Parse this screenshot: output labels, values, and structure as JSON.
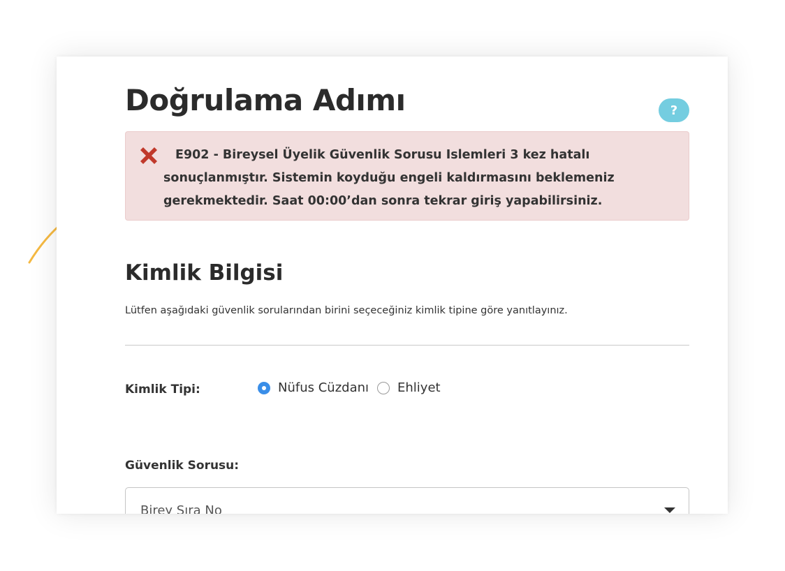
{
  "page": {
    "title": "Doğrulama Adımı",
    "help_label": "?"
  },
  "alert": {
    "message": "E902 - Bireysel Üyelik Güvenlik Sorusu Islemleri 3 kez hatalı sonuçlanmıştır. Sistemin koyduğu engeli kaldırmasını beklemeniz gerekmektedir. Saat 00:00’dan sonra tekrar giriş yapabilirsiniz.",
    "icon": "close-icon",
    "background": "#f2dede",
    "icon_color": "#c0392b"
  },
  "identity": {
    "section_title": "Kimlik Bilgisi",
    "description": "Lütfen aşağıdaki güvenlik sorularından birini seçeceğiniz kimlik tipine göre yanıtlayınız.",
    "id_type_label": "Kimlik Tipi:",
    "options": [
      {
        "label": "Nüfus Cüzdanı",
        "checked": true
      },
      {
        "label": "Ehliyet",
        "checked": false
      }
    ],
    "security_question_label": "Güvenlik Sorusu:",
    "security_question_value": "Birey Sıra No"
  },
  "colors": {
    "help_button": "#74cde0",
    "radio_accent": "#3a8ee8",
    "annotation_arrow": "#f5b942"
  }
}
